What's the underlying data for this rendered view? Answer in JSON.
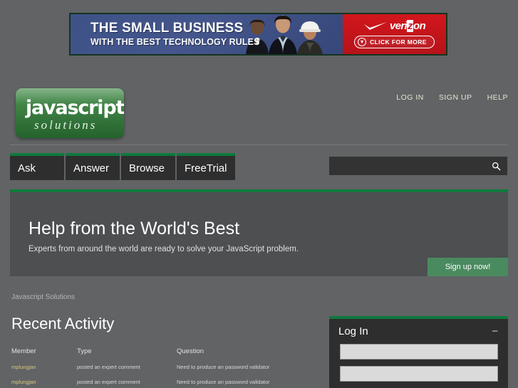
{
  "ad": {
    "headline": "THE SMALL BUSINESS",
    "subhead": "WITH THE BEST TECHNOLOGY RULES",
    "brand": "verizon",
    "cta": "CLICK FOR MORE",
    "colors": {
      "panel_blue": "#44568c",
      "panel_red": "#d2161c"
    }
  },
  "header": {
    "logo_primary": "javascript",
    "logo_secondary": "solutions",
    "nav": [
      {
        "label": "LOG IN"
      },
      {
        "label": "SIGN UP"
      },
      {
        "label": "HELP"
      }
    ]
  },
  "tabs": [
    {
      "label": "Ask"
    },
    {
      "label": "Answer"
    },
    {
      "label": "Browse"
    },
    {
      "label": "FreeTrial"
    }
  ],
  "search": {
    "value": "",
    "placeholder": "",
    "icon": "search-icon"
  },
  "hero": {
    "title": "Help from the World's Best",
    "subtitle": "Experts from around the world are ready to solve your JavaScript problem.",
    "button_label": "Sign up now!",
    "accent": "#0f7a3d"
  },
  "breadcrumb": {
    "label": "Javascript Solutions"
  },
  "activity": {
    "title": "Recent Activity",
    "columns": [
      "Member",
      "Type",
      "Question"
    ],
    "rows": [
      {
        "member": "mplungjan",
        "type": "posted an expert comment",
        "question": "Need to produce an password validator"
      },
      {
        "member": "mplungjan",
        "type": "posted an expert comment",
        "question": "Need to produce an password validator"
      }
    ]
  },
  "login": {
    "title": "Log In",
    "minimize_label": "−",
    "username_value": "",
    "username_placeholder": "",
    "password_value": "",
    "password_placeholder": ""
  }
}
